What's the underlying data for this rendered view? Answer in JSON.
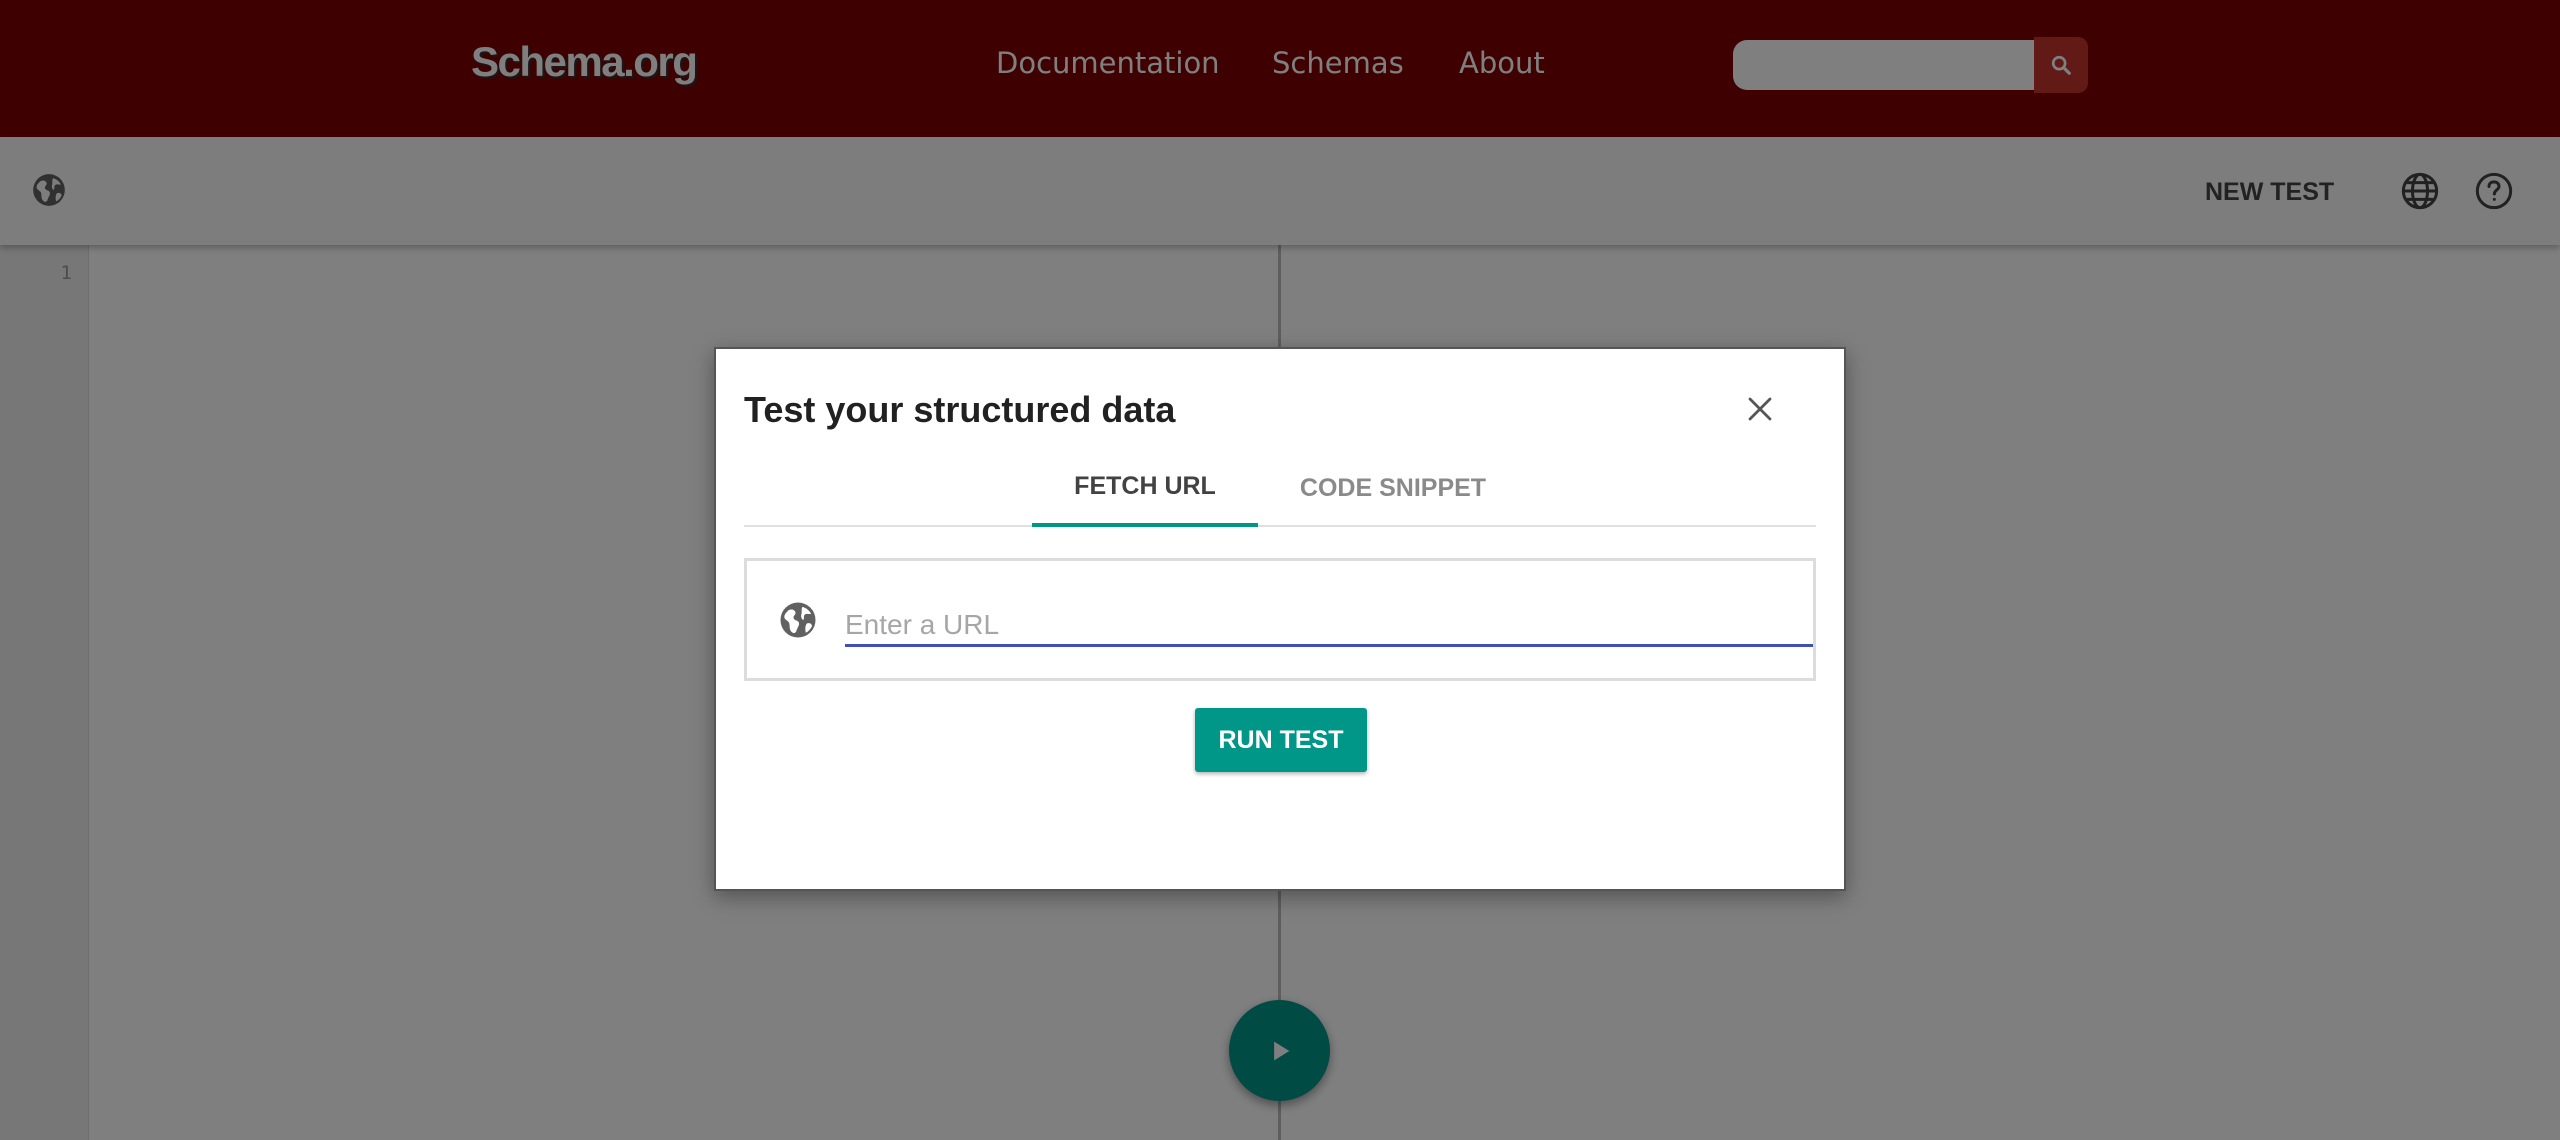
{
  "site_header": {
    "logo": "Schema.org",
    "nav": {
      "documentation": "Documentation",
      "schemas": "Schemas",
      "about": "About"
    },
    "search": {
      "placeholder": "",
      "button_icon": "search-icon"
    }
  },
  "toolbar": {
    "new_test_label": "NEW TEST",
    "icons": [
      "globe-icon",
      "language-icon",
      "help-icon"
    ]
  },
  "editor": {
    "line_numbers": [
      "1"
    ]
  },
  "modal": {
    "title": "Test your structured data",
    "tabs": [
      {
        "label": "FETCH URL",
        "active": true
      },
      {
        "label": "CODE SNIPPET",
        "active": false
      }
    ],
    "url_input": {
      "placeholder": "Enter a URL",
      "value": ""
    },
    "run_button_label": "RUN TEST"
  },
  "colors": {
    "header_bg": "#7d0000",
    "accent_teal": "#009688",
    "input_underline": "#3f51b5",
    "overlay": "rgba(0,0,0,0.5)"
  }
}
